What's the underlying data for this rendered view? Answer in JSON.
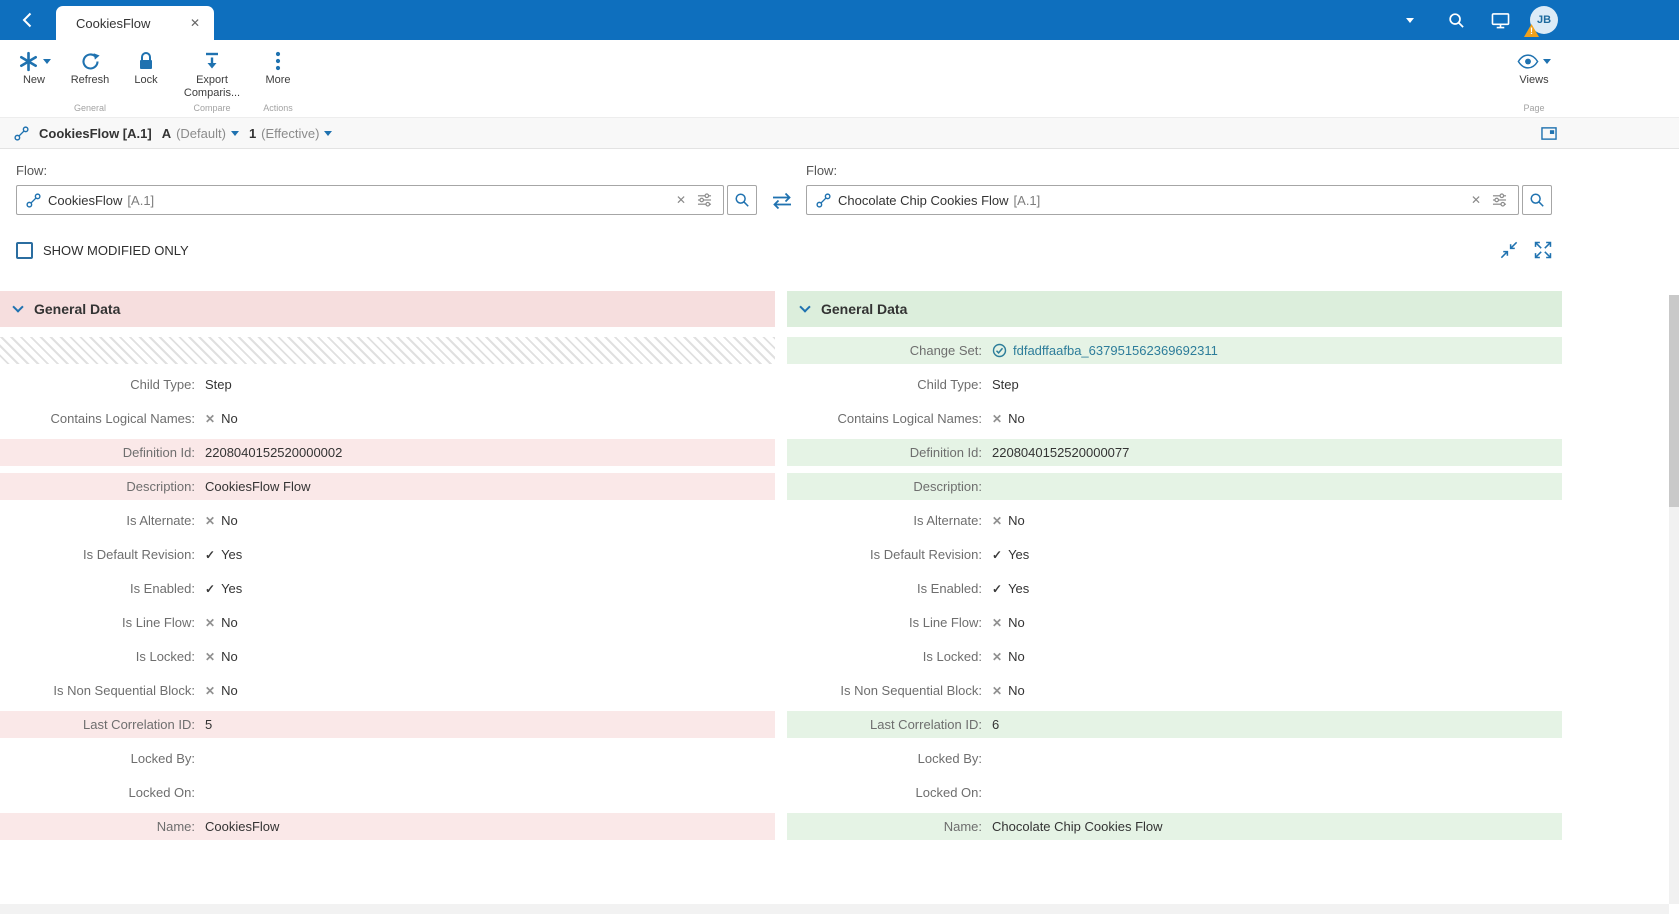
{
  "icons": {
    "close": "✕",
    "clear": "✕",
    "check": "✓",
    "cross": "✕"
  },
  "topbar": {
    "tab_title": "CookiesFlow",
    "avatar_initials": "JB",
    "warning": "!"
  },
  "ribbon": {
    "new_label": "New",
    "refresh_label": "Refresh",
    "lock_label": "Lock",
    "export_label": "Export Comparis...",
    "more_label": "More",
    "views_label": "Views",
    "group_general": "General",
    "group_compare": "Compare",
    "group_actions": "Actions",
    "group_page": "Page"
  },
  "breadcrumb": {
    "title": "CookiesFlow [A.1]",
    "revision": "A",
    "revision_qualifier": "(Default)",
    "version": "1",
    "version_qualifier": "(Effective)"
  },
  "selectors": {
    "left": {
      "label": "Flow:",
      "value": "CookiesFlow",
      "suffix": "[A.1]"
    },
    "right": {
      "label": "Flow:",
      "value": "Chocolate Chip Cookies Flow",
      "suffix": "[A.1]"
    }
  },
  "controls": {
    "show_modified": "SHOW MODIFIED ONLY"
  },
  "comparison": {
    "left": {
      "section_title": "General Data",
      "rows": [
        {
          "state": "missing"
        },
        {
          "label": "Child Type:",
          "value": "Step",
          "state": "same",
          "kind": "text"
        },
        {
          "label": "Contains Logical Names:",
          "value": "No",
          "state": "same",
          "kind": "no"
        },
        {
          "label": "Definition Id:",
          "value": "2208040152520000002",
          "state": "diff",
          "kind": "text"
        },
        {
          "label": "Description:",
          "value": "CookiesFlow Flow",
          "state": "diff",
          "kind": "text"
        },
        {
          "label": "Is Alternate:",
          "value": "No",
          "state": "same",
          "kind": "no"
        },
        {
          "label": "Is Default Revision:",
          "value": "Yes",
          "state": "same",
          "kind": "yes"
        },
        {
          "label": "Is Enabled:",
          "value": "Yes",
          "state": "same",
          "kind": "yes"
        },
        {
          "label": "Is Line Flow:",
          "value": "No",
          "state": "same",
          "kind": "no"
        },
        {
          "label": "Is Locked:",
          "value": "No",
          "state": "same",
          "kind": "no"
        },
        {
          "label": "Is Non Sequential Block:",
          "value": "No",
          "state": "same",
          "kind": "no"
        },
        {
          "label": "Last Correlation ID:",
          "value": "5",
          "state": "diff",
          "kind": "text"
        },
        {
          "label": "Locked By:",
          "value": "",
          "state": "same",
          "kind": "text"
        },
        {
          "label": "Locked On:",
          "value": "",
          "state": "same",
          "kind": "text"
        },
        {
          "label": "Name:",
          "value": "CookiesFlow",
          "state": "diff",
          "kind": "text"
        }
      ]
    },
    "right": {
      "section_title": "General Data",
      "rows": [
        {
          "label": "Change Set:",
          "value": "fdfadffaafba_637951562369692311",
          "state": "diff",
          "kind": "link"
        },
        {
          "label": "Child Type:",
          "value": "Step",
          "state": "same",
          "kind": "text"
        },
        {
          "label": "Contains Logical Names:",
          "value": "No",
          "state": "same",
          "kind": "no"
        },
        {
          "label": "Definition Id:",
          "value": "2208040152520000077",
          "state": "diff",
          "kind": "text"
        },
        {
          "label": "Description:",
          "value": "",
          "state": "diff",
          "kind": "text"
        },
        {
          "label": "Is Alternate:",
          "value": "No",
          "state": "same",
          "kind": "no"
        },
        {
          "label": "Is Default Revision:",
          "value": "Yes",
          "state": "same",
          "kind": "yes"
        },
        {
          "label": "Is Enabled:",
          "value": "Yes",
          "state": "same",
          "kind": "yes"
        },
        {
          "label": "Is Line Flow:",
          "value": "No",
          "state": "same",
          "kind": "no"
        },
        {
          "label": "Is Locked:",
          "value": "No",
          "state": "same",
          "kind": "no"
        },
        {
          "label": "Is Non Sequential Block:",
          "value": "No",
          "state": "same",
          "kind": "no"
        },
        {
          "label": "Last Correlation ID:",
          "value": "6",
          "state": "diff",
          "kind": "text"
        },
        {
          "label": "Locked By:",
          "value": "",
          "state": "same",
          "kind": "text"
        },
        {
          "label": "Locked On:",
          "value": "",
          "state": "same",
          "kind": "text"
        },
        {
          "label": "Name:",
          "value": "Chocolate Chip Cookies Flow",
          "state": "diff",
          "kind": "text"
        }
      ]
    }
  },
  "colors": {
    "topbar_blue": "#0e6fbe",
    "icon_blue": "#1f72b0",
    "removed_row_bg": "#fae8e8",
    "added_row_bg": "#e5f3e5",
    "removed_header_bg": "#f6dede",
    "added_header_bg": "#dceedc",
    "link": "#2d7d9a"
  }
}
